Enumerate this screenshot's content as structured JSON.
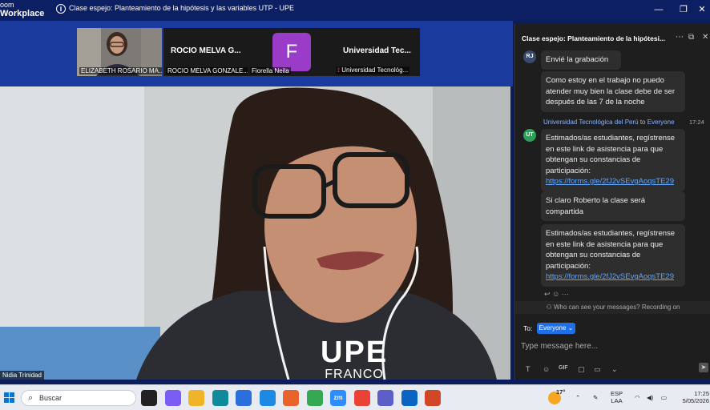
{
  "window": {
    "brand_line1": "oom",
    "brand_line2": "Workplace",
    "title": "Clase espejo: Planteamiento de la hipótesis y las variables UTP - UPE",
    "minimize": "—",
    "restore": "❐",
    "close": "✕"
  },
  "participants": [
    {
      "name": "ELIZABETH ROSARIO MA..."
    },
    {
      "display": "ROCIO MELVA G...",
      "name": "ROCIO MELVA GONZALE..."
    },
    {
      "avatar_letter": "F",
      "name": "Fiorella Neila"
    },
    {
      "display": "Universidad Tec...",
      "name": "Universidad Tecnológ..."
    }
  ],
  "speaker": {
    "name": "Nidia Trinidad",
    "watermark_line1": "UPE",
    "watermark_line2": "FRANCO"
  },
  "chat": {
    "title": "Clase espejo: Planteamiento de la hipótesi...",
    "messages": [
      {
        "initials": "RJ",
        "text": "Envié la grabación"
      },
      {
        "text": "Como estoy en el trabajo no puedo atender muy bien la clase debe de ser después de las 7 de la noche"
      },
      {
        "initials": "UT",
        "sender": "Universidad Tecnológica del Perú",
        "to": "to",
        "recipient": "Everyone",
        "time": "17:24",
        "text": "Estimados/as estudiantes, regístrense en este link de asistencia para que obtengan su constancias de participación:",
        "link": "https://forms.gle/2fJ2vSEvgAoqsTE29"
      },
      {
        "text": "Si claro Roberto la clase será compartida"
      },
      {
        "text": "Estimados/as estudiantes, regístrense en este link de asistencia para que obtengan su constancias de participación:",
        "link": "https://forms.gle/2fJ2vSEvgAoqsTE29"
      }
    ],
    "more": "···",
    "privacy": "Who can see your messages? Recording on",
    "to_label": "To:",
    "recipient_button": "Everyone ⌄",
    "input_placeholder": "Type message here..."
  },
  "taskbar": {
    "search_label": "Buscar",
    "apps": [
      {
        "name": "task-view",
        "color": "#222222"
      },
      {
        "name": "copilot",
        "color": "#7b5cf5"
      },
      {
        "name": "file-explorer",
        "color": "#f0b429"
      },
      {
        "name": "edge",
        "color": "#0f8a9c"
      },
      {
        "name": "store",
        "color": "#2a6fdb"
      },
      {
        "name": "todo",
        "color": "#1e88e5"
      },
      {
        "name": "firefox",
        "color": "#e8642c"
      },
      {
        "name": "chrome",
        "color": "#34a853"
      },
      {
        "name": "zoom",
        "color": "#2d8cff",
        "label": "zm"
      },
      {
        "name": "chrome-2",
        "color": "#ea4335"
      },
      {
        "name": "teams",
        "color": "#5b5fc7"
      },
      {
        "name": "outlook",
        "color": "#0a64c2"
      },
      {
        "name": "powerpoint",
        "color": "#d24726"
      }
    ],
    "weather_temp": "17°",
    "language_line1": "ESP",
    "language_line2": "LAA",
    "time": "17:25",
    "date": "5/05/2026"
  }
}
